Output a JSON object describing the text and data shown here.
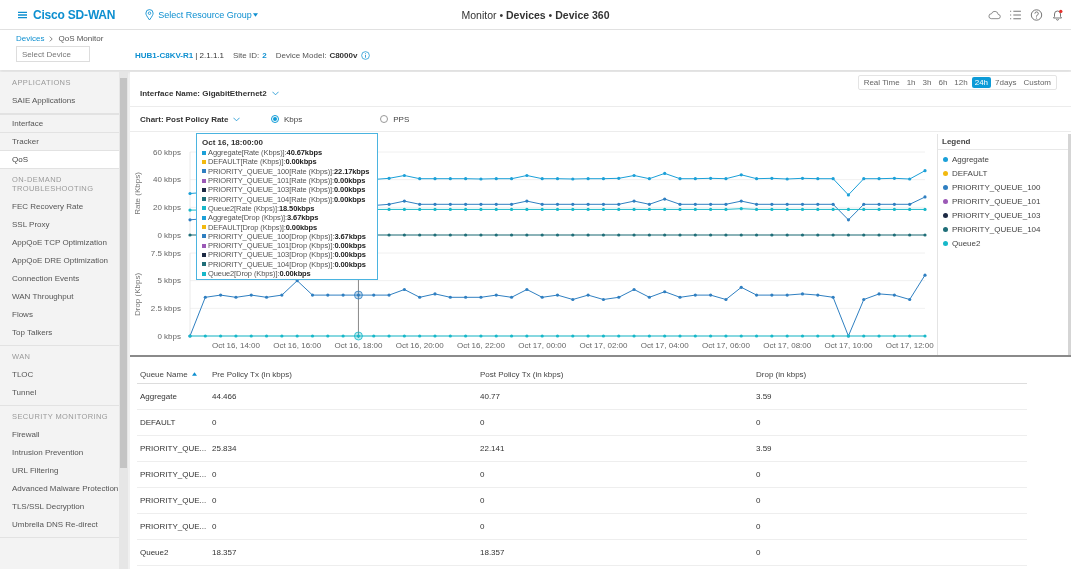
{
  "header": {
    "brand": "Cisco SD-WAN",
    "resource_group": "Select Resource Group",
    "title": "Monitor • **Devices** • **Device 360**"
  },
  "breadcrumb": [
    {
      "label": "Devices",
      "kind": "link"
    },
    {
      "label": "QoS Monitor",
      "kind": "current"
    }
  ],
  "device_select": {
    "placeholder": "Select Device"
  },
  "device_info": {
    "hostname": "HUB1-C8KV-R1",
    "system_ip": "| 2.1.1.1",
    "site_label": "Site ID:",
    "site_id": "2",
    "model_label": "Device Model:",
    "model": "C8000v"
  },
  "sidebar": {
    "sections": [
      {
        "heading": "APPLICATIONS",
        "items": [
          {
            "label": "SAIE Applications",
            "selected": false
          }
        ]
      },
      {
        "items": [
          {
            "label": "Interface",
            "selected": false
          },
          {
            "label": "Tracker",
            "selected": false
          },
          {
            "label": "QoS",
            "selected": true
          }
        ]
      },
      {
        "heading": "ON-DEMAND TROUBLESHOOTING",
        "items": [
          {
            "label": "FEC Recovery Rate",
            "selected": false
          },
          {
            "label": "SSL Proxy",
            "selected": false
          },
          {
            "label": "AppQoE TCP Optimization",
            "selected": false
          },
          {
            "label": "AppQoE DRE Optimization",
            "selected": false
          },
          {
            "label": "Connection Events",
            "selected": false
          },
          {
            "label": "WAN Throughput",
            "selected": false
          },
          {
            "label": "Flows",
            "selected": false
          },
          {
            "label": "Top Talkers",
            "selected": false
          }
        ]
      },
      {
        "heading": "WAN",
        "items": [
          {
            "label": "TLOC",
            "selected": false
          },
          {
            "label": "Tunnel",
            "selected": false
          }
        ]
      },
      {
        "heading": "SECURITY MONITORING",
        "items": [
          {
            "label": "Firewall",
            "selected": false
          },
          {
            "label": "Intrusion Prevention",
            "selected": false
          },
          {
            "label": "URL Filtering",
            "selected": false
          },
          {
            "label": "Advanced Malware Protection",
            "selected": false
          },
          {
            "label": "TLS/SSL Decryption",
            "selected": false
          },
          {
            "label": "Umbrella DNS Re-direct",
            "selected": false
          }
        ]
      }
    ]
  },
  "time_ranges": [
    {
      "label": "Real Time",
      "selected": false
    },
    {
      "label": "1h",
      "selected": false
    },
    {
      "label": "3h",
      "selected": false
    },
    {
      "label": "6h",
      "selected": false
    },
    {
      "label": "12h",
      "selected": false
    },
    {
      "label": "24h",
      "selected": true
    },
    {
      "label": "7days",
      "selected": false
    },
    {
      "label": "Custom",
      "selected": false
    }
  ],
  "interface": {
    "label": "Interface Name: GigabitEthernet2"
  },
  "chart_selector": {
    "label": "Chart: Post Policy Rate"
  },
  "units": [
    {
      "label": "Kbps",
      "selected": true
    },
    {
      "label": "PPS",
      "selected": false
    }
  ],
  "tooltip": {
    "title": "Oct 16, 18:00:00",
    "entries": [
      {
        "text": "Aggregate[Rate (Kbps)]:**40.67kbps**",
        "color": "#1ba0d8"
      },
      {
        "text": "DEFAULT[Rate (Kbps)]:**0.00kbps**",
        "color": "#f2b90f"
      },
      {
        "text": "PRIORITY_QUEUE_100[Rate (Kbps)]:**22.17kbps**",
        "color": "#2f7fc1"
      },
      {
        "text": "PRIORITY_QUEUE_101[Rate (Kbps)]:**0.00kbps**",
        "color": "#9b59b6"
      },
      {
        "text": "PRIORITY_QUEUE_103[Rate (Kbps)]:**0.00kbps**",
        "color": "#1d2a44"
      },
      {
        "text": "PRIORITY_QUEUE_104[Rate (Kbps)]:**0.00kbps**",
        "color": "#1f6e78"
      },
      {
        "text": "Queue2[Rate (Kbps)]:**18.50kbps**",
        "color": "#17b8c9"
      },
      {
        "text": "Aggregate[Drop (Kbps)]:**3.67kbps**",
        "color": "#1ba0d8"
      },
      {
        "text": "DEFAULT[Drop (Kbps)]:**0.00kbps**",
        "color": "#f2b90f"
      },
      {
        "text": "PRIORITY_QUEUE_100[Drop (Kbps)]:**3.67kbps**",
        "color": "#2f7fc1"
      },
      {
        "text": "PRIORITY_QUEUE_101[Drop (Kbps)]:**0.00kbps**",
        "color": "#9b59b6"
      },
      {
        "text": "PRIORITY_QUEUE_103[Drop (Kbps)]:**0.00kbps**",
        "color": "#1d2a44"
      },
      {
        "text": "PRIORITY_QUEUE_104[Drop (Kbps)]:**0.00kbps**",
        "color": "#1f6e78"
      },
      {
        "text": "Queue2[Drop (Kbps)]:**0.00kbps**",
        "color": "#17b8c9"
      }
    ]
  },
  "rate_chart": {
    "chart_data": {
      "type": "line",
      "ylabel": "Rate (Kbps)",
      "categories": [
        null,
        null,
        null,
        null,
        null,
        null,
        null,
        null,
        null,
        null,
        null,
        null,
        null,
        null,
        null,
        null,
        null,
        null,
        null,
        null,
        null,
        null,
        null,
        null,
        null,
        null,
        null,
        null,
        null,
        null,
        null,
        null,
        null,
        null,
        null,
        null,
        null,
        null,
        null,
        null,
        null,
        null,
        null,
        null,
        null,
        null,
        null,
        null,
        null
      ],
      "ylim": [
        0,
        60
      ],
      "yticks": [
        {
          "value": 0,
          "label": "0 kbps"
        },
        {
          "value": 20,
          "label": "20 kbps"
        },
        {
          "value": 40,
          "label": "40 kbps"
        },
        {
          "value": 60,
          "label": "60 kbps"
        }
      ],
      "series": [
        {
          "color": "#1ba0d8",
          "values": [
            30,
            null,
            null,
            null,
            null,
            null,
            null,
            null,
            null,
            null,
            null,
            null,
            null,
            41,
            43,
            40.7,
            40.7,
            40.7,
            40.7,
            40.5,
            40.7,
            40.7,
            43,
            40.7,
            40.7,
            40.5,
            40.7,
            40.7,
            41,
            43,
            40.7,
            44.5,
            40.7,
            40.7,
            41,
            40.7,
            43.5,
            40.7,
            41,
            40.5,
            41,
            40.7,
            40.7,
            29,
            40.7,
            40.7,
            41,
            40.5,
            46.5
          ]
        },
        {
          "color": "#2f7fc1",
          "values": [
            11,
            null,
            null,
            null,
            null,
            null,
            null,
            null,
            null,
            null,
            null,
            null,
            null,
            22.2,
            24.5,
            22.2,
            22.2,
            22.2,
            22.2,
            22.2,
            22.2,
            22.2,
            24.5,
            22.2,
            22.2,
            22.2,
            22.2,
            22.2,
            22.2,
            24.5,
            22.2,
            26,
            22.2,
            22.2,
            22.2,
            22.2,
            24.5,
            22.2,
            22.2,
            22.2,
            22.2,
            22.2,
            22.2,
            11,
            22.2,
            22.2,
            22.2,
            22.2,
            27.5
          ]
        },
        {
          "color": "#17b8c9",
          "values": [
            18,
            null,
            null,
            null,
            null,
            null,
            null,
            null,
            null,
            null,
            null,
            null,
            null,
            18.5,
            18.5,
            18.5,
            18.5,
            18.5,
            18.5,
            18.5,
            18.5,
            18.5,
            18.5,
            18.5,
            18.5,
            18.5,
            18.5,
            18.5,
            18.5,
            18.5,
            18.5,
            18.5,
            18.5,
            18.5,
            18.5,
            18.5,
            19,
            18.5,
            18.5,
            18.5,
            18.5,
            18.5,
            18.5,
            18.5,
            18.5,
            18.5,
            18.5,
            18.5,
            18.5
          ]
        },
        {
          "color": "#1f6e78",
          "values": [
            0,
            null,
            null,
            null,
            null,
            null,
            null,
            null,
            null,
            null,
            null,
            null,
            null,
            0,
            0,
            0,
            0,
            0,
            0,
            0,
            0,
            0,
            0,
            0,
            0,
            0,
            0,
            0,
            0,
            0,
            0,
            0,
            0,
            0,
            0,
            0,
            0,
            0,
            0,
            0,
            0,
            0,
            0,
            0,
            0,
            0,
            0,
            0,
            0
          ]
        }
      ]
    }
  },
  "drop_chart": {
    "chart_data": {
      "type": "line",
      "ylabel": "Drop (Kbps)",
      "categories": [
        null,
        null,
        null,
        "Oct 16, 14:00",
        null,
        null,
        null,
        "Oct 16, 16:00",
        null,
        null,
        null,
        "Oct 16, 18:00",
        null,
        null,
        null,
        "Oct 16, 20:00",
        null,
        null,
        null,
        "Oct 16, 22:00",
        null,
        null,
        null,
        "Oct 17, 00:00",
        null,
        null,
        null,
        "Oct 17, 02:00",
        null,
        null,
        null,
        "Oct 17, 04:00",
        null,
        null,
        null,
        "Oct 17, 06:00",
        null,
        null,
        null,
        "Oct 17, 08:00",
        null,
        null,
        null,
        "Oct 17, 10:00",
        null,
        null,
        null,
        "Oct 17, 12:00",
        null
      ],
      "ylim": [
        0,
        7.5
      ],
      "yticks": [
        {
          "value": 0,
          "label": "0 kbps"
        },
        {
          "value": 2.5,
          "label": "2.5 kbps"
        },
        {
          "value": 5,
          "label": "5 kbps"
        },
        {
          "value": 7.5,
          "label": "7.5 kbps"
        }
      ],
      "annotations": [
        {
          "x": "Oct 16, 18:00"
        }
      ],
      "series": [
        {
          "color": "#2f7fc1",
          "values": [
            0,
            3.5,
            3.7,
            3.5,
            3.7,
            3.5,
            3.7,
            5,
            3.7,
            3.7,
            3.7,
            3.7,
            3.7,
            3.7,
            4.2,
            3.5,
            3.8,
            3.5,
            3.5,
            3.5,
            3.7,
            3.5,
            4.2,
            3.5,
            3.7,
            3.3,
            3.7,
            3.3,
            3.5,
            4.2,
            3.5,
            4,
            3.5,
            3.7,
            3.7,
            3.3,
            4.4,
            3.7,
            3.7,
            3.7,
            3.8,
            3.7,
            3.5,
            0,
            3.3,
            3.8,
            3.7,
            3.3,
            5.5
          ]
        },
        {
          "color": "#17b8c9",
          "values": [
            0,
            0,
            0,
            0,
            0,
            0,
            0,
            0,
            0,
            0,
            0,
            0,
            0,
            0,
            0,
            0,
            0,
            0,
            0,
            0,
            0,
            0,
            0,
            0,
            0,
            0,
            0,
            0,
            0,
            0,
            0,
            0,
            0,
            0,
            0,
            0,
            0,
            0,
            0,
            0,
            0,
            0,
            0,
            0,
            0,
            0,
            0,
            0,
            0
          ]
        }
      ]
    }
  },
  "legend": {
    "title": "Legend",
    "items": [
      {
        "label": "Aggregate",
        "color": "#1ba0d8"
      },
      {
        "label": "DEFAULT",
        "color": "#f2b90f"
      },
      {
        "label": "PRIORITY_QUEUE_100",
        "color": "#2f7fc1"
      },
      {
        "label": "PRIORITY_QUEUE_101",
        "color": "#9b59b6"
      },
      {
        "label": "PRIORITY_QUEUE_103",
        "color": "#1d2a44"
      },
      {
        "label": "PRIORITY_QUEUE_104",
        "color": "#1f6e78"
      },
      {
        "label": "Queue2",
        "color": "#17b8c9"
      }
    ]
  },
  "table": {
    "columns": [
      {
        "label": "Queue Name",
        "sorted": true
      },
      {
        "label": "Pre Policy Tx (in kbps)",
        "sorted": false
      },
      {
        "label": "Post Policy Tx (in kbps)",
        "sorted": false
      },
      {
        "label": "Drop (in kbps)",
        "sorted": false
      }
    ],
    "rows": [
      [
        "Aggregate",
        "44.466",
        "40.77",
        "3.59"
      ],
      [
        "DEFAULT",
        "0",
        "0",
        "0"
      ],
      [
        "PRIORITY_QUE...",
        "25.834",
        "22.141",
        "3.59"
      ],
      [
        "PRIORITY_QUE...",
        "0",
        "0",
        "0"
      ],
      [
        "PRIORITY_QUE...",
        "0",
        "0",
        "0"
      ],
      [
        "PRIORITY_QUE...",
        "0",
        "0",
        "0"
      ],
      [
        "Queue2",
        "18.357",
        "18.357",
        "0"
      ]
    ]
  }
}
